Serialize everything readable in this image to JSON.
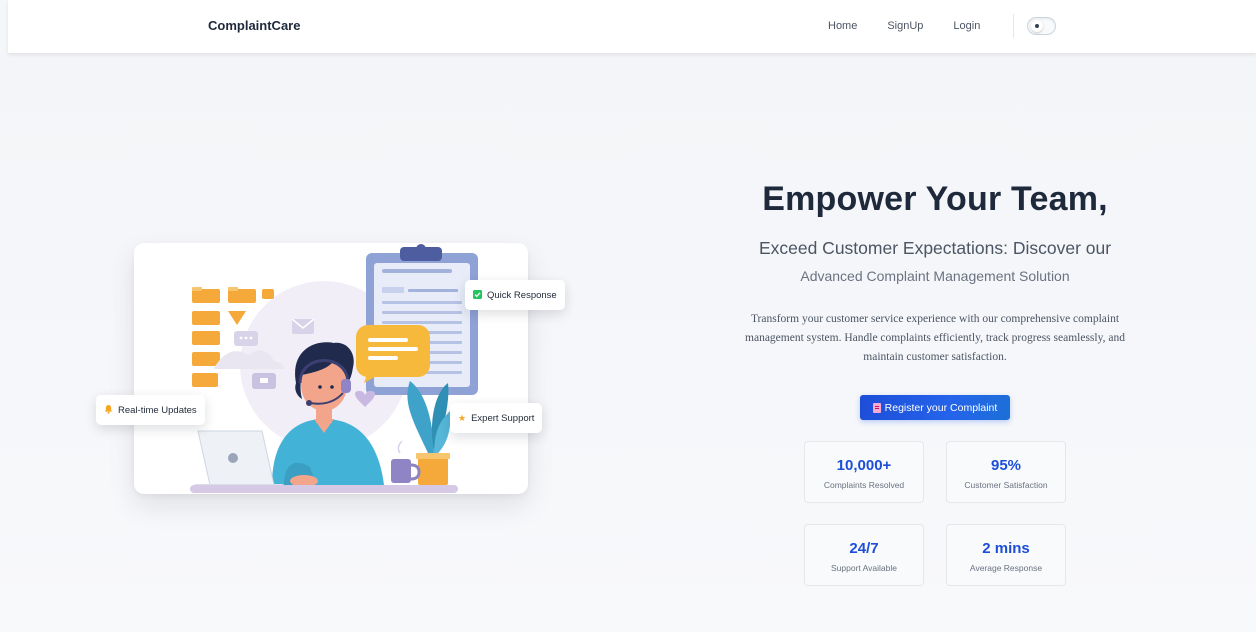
{
  "nav": {
    "brand": "ComplaintCare",
    "links": [
      "Home",
      "SignUp",
      "Login"
    ]
  },
  "hero": {
    "title": "Empower Your Team,",
    "subtitle": "Exceed Customer Expectations: Discover our",
    "subtitle2": "Advanced Complaint Management Solution",
    "description": "Transform your customer service experience with our comprehensive complaint management system. Handle complaints efficiently, track progress seamlessly, and maintain customer satisfaction.",
    "cta_label": "Register your Complaint"
  },
  "badges": {
    "quick": "Quick Response",
    "expert": "Expert Support",
    "realtime": "Real-time Updates"
  },
  "stats": [
    {
      "value": "10,000+",
      "label": "Complaints Resolved"
    },
    {
      "value": "95%",
      "label": "Customer Satisfaction"
    },
    {
      "value": "24/7",
      "label": "Support Available"
    },
    {
      "value": "2 mins",
      "label": "Average Response"
    }
  ],
  "colors": {
    "accent": "#2563eb",
    "stat_value": "#1d4ed8"
  }
}
